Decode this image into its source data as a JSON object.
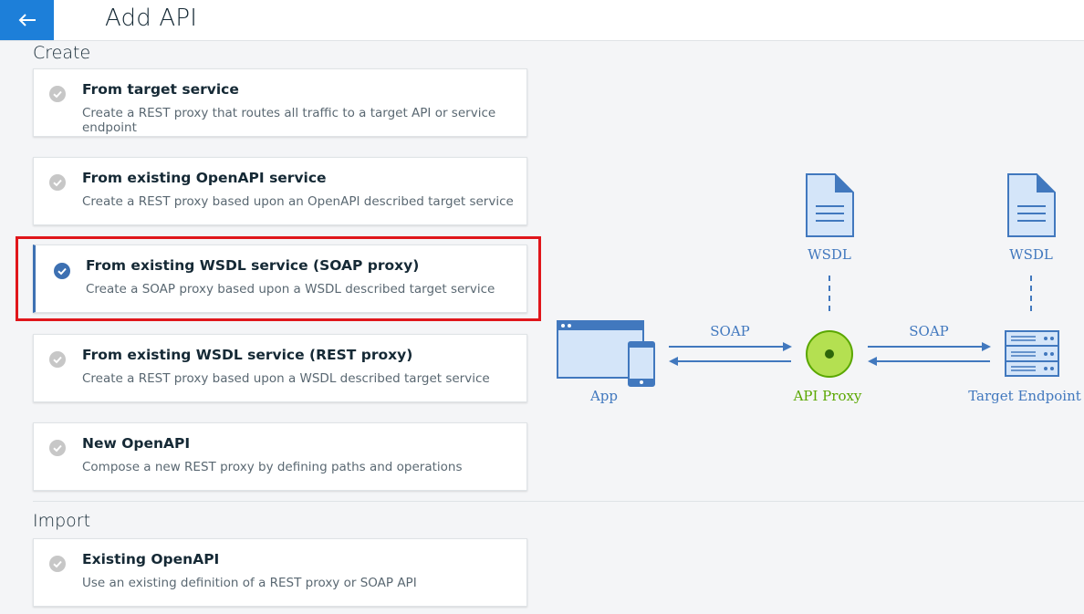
{
  "header": {
    "title": "Add API",
    "back_icon": "arrow-left-icon"
  },
  "sections": {
    "create": "Create",
    "import": "Import"
  },
  "create_options": [
    {
      "title": "From target service",
      "description": "Create a REST proxy that routes all traffic to a target API or service endpoint",
      "selected": false
    },
    {
      "title": "From existing OpenAPI service",
      "description": "Create a REST proxy based upon an OpenAPI described target service",
      "selected": false
    },
    {
      "title": "From existing WSDL service (SOAP proxy)",
      "description": "Create a SOAP proxy based upon a WSDL described target service",
      "selected": true
    },
    {
      "title": "From existing WSDL service (REST proxy)",
      "description": "Create a REST proxy based upon a WSDL described target service",
      "selected": false
    },
    {
      "title": "New OpenAPI",
      "description": "Compose a new REST proxy by defining paths and operations",
      "selected": false
    }
  ],
  "import_options": [
    {
      "title": "Existing OpenAPI",
      "description": "Use an existing definition of a REST proxy or SOAP API",
      "selected": false
    }
  ],
  "diagram": {
    "app_label": "App",
    "proxy_label": "API Proxy",
    "endpoint_label": "Target Endpoint",
    "wsdl_left": "WSDL",
    "wsdl_right": "WSDL",
    "protocol_left": "SOAP",
    "protocol_right": "SOAP"
  },
  "colors": {
    "accent": "#1d7fd9",
    "selected": "#3d70b2",
    "highlight": "#e0161b",
    "diagram_blue": "#4178be",
    "proxy_green": "#5aa700"
  }
}
